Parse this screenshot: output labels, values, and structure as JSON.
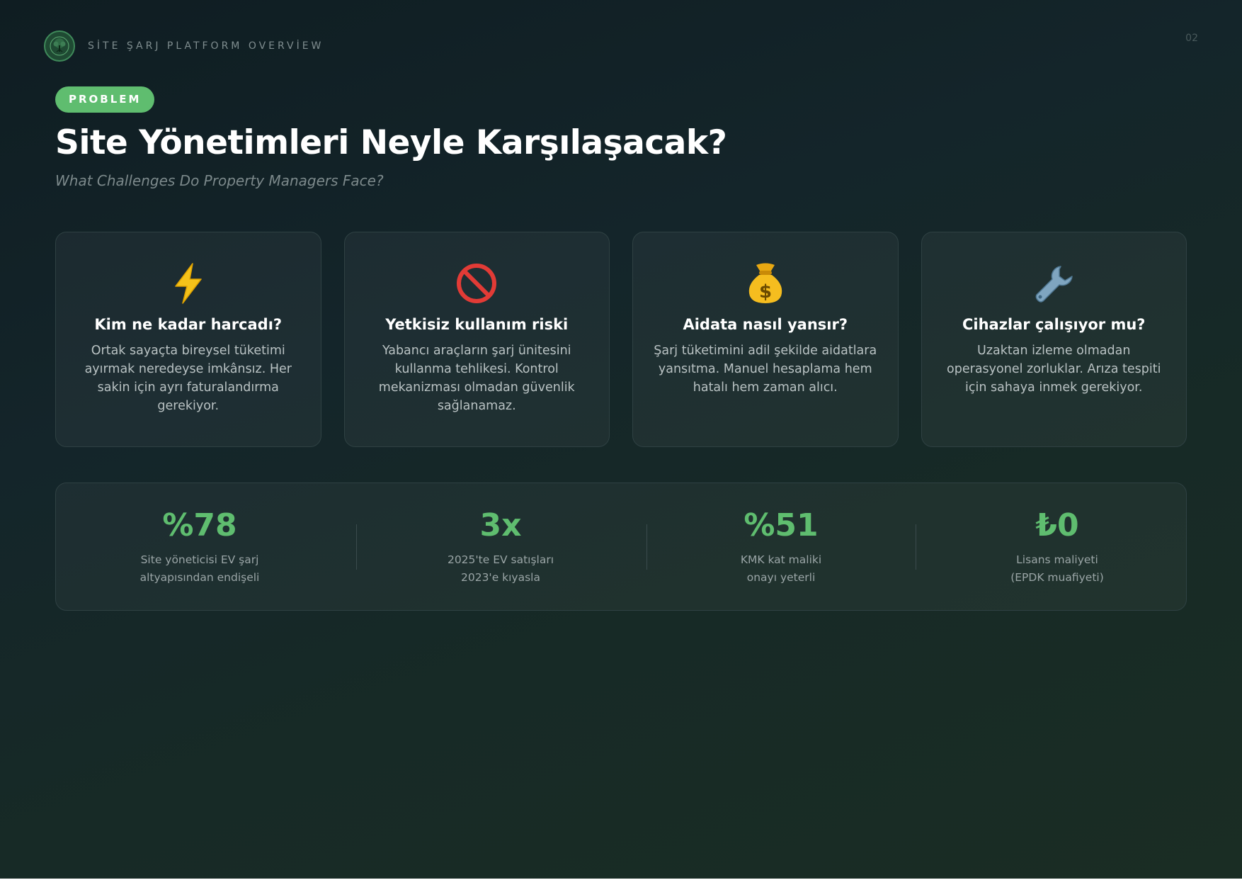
{
  "header": {
    "brand": "SİTE ŞARJ PLATFORM OVERVİEW",
    "page_number": "02",
    "logo_icon": "tree-icon"
  },
  "badge": "PROBLEM",
  "title": "Site Yönetimleri Neyle Karşılaşacak?",
  "subtitle": "What Challenges Do Property Managers Face?",
  "cards": [
    {
      "icon": "lightning-icon",
      "title": "Kim ne kadar harcadı?",
      "description": "Ortak sayaçta bireysel tüketimi ayırmak neredeyse imkânsız. Her sakin için ayrı faturalandırma gerekiyor."
    },
    {
      "icon": "prohibited-icon",
      "title": "Yetkisiz kullanım riski",
      "description": "Yabancı araçların şarj ünitesini kullanma tehlikesi. Kontrol mekanizması olmadan güvenlik sağlanamaz."
    },
    {
      "icon": "money-bag-icon",
      "title": "Aidata nasıl yansır?",
      "description": "Şarj tüketimini adil şekilde aidatlara yansıtma. Manuel hesaplama hem hatalı hem zaman alıcı."
    },
    {
      "icon": "wrench-icon",
      "title": "Cihazlar çalışıyor mu?",
      "description": "Uzaktan izleme olmadan operasyonel zorluklar. Arıza tespiti için sahaya inmek gerekiyor."
    }
  ],
  "stats": [
    {
      "value": "%78",
      "label_line1": "Site yöneticisi EV şarj",
      "label_line2": "altyapısından endişeli"
    },
    {
      "value": "3x",
      "label_line1": "2025'te EV satışları",
      "label_line2": "2023'e kıyasla"
    },
    {
      "value": "%51",
      "label_line1": "KMK kat maliki",
      "label_line2": "onayı yeterli"
    },
    {
      "value": "₺0",
      "label_line1": "Lisans maliyeti",
      "label_line2": "(EPDK muafiyeti)"
    }
  ],
  "colors": {
    "accent": "#5fbd6f",
    "background": "#14252a",
    "card_border": "#2f4143"
  }
}
